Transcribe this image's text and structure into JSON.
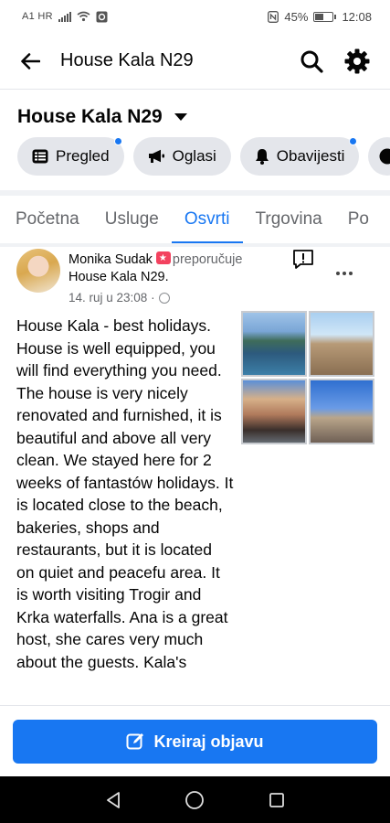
{
  "status_bar": {
    "carrier": "A1 HR",
    "battery": "45%",
    "time": "12:08"
  },
  "app_bar": {
    "title": "House Kala N29"
  },
  "page_header": {
    "name": "House Kala N29",
    "chips": [
      {
        "label": "Pregled",
        "icon": "dashboard-icon",
        "badge": true
      },
      {
        "label": "Oglasi",
        "icon": "megaphone-icon",
        "badge": false
      },
      {
        "label": "Obavijesti",
        "icon": "bell-icon",
        "badge": true
      }
    ]
  },
  "tabs": [
    {
      "label": "Početna",
      "active": false
    },
    {
      "label": "Usluge",
      "active": false
    },
    {
      "label": "Osvrti",
      "active": true
    },
    {
      "label": "Trgovina",
      "active": false
    },
    {
      "label": "Po",
      "active": false
    }
  ],
  "post": {
    "author": "Monika Sudak",
    "verb": "preporučuje",
    "page": "House Kala N29.",
    "timestamp": "14. ruj u 23:08 ·",
    "text": "House Kala - best holidays. House is well equipped, you will find everything you need. The house is very nicely renovated and furnished, it is beautiful and above all very clean. We stayed here for 2 weeks of fantastów holidays. It is located close to the beach, bakeries, shops and restaurants, but it is located on quiet and peacefu area. It is worth visiting Trogir and Krka waterfalls. Ana is a great host, she cares very much about the guests. Kala's"
  },
  "create_post": {
    "label": "Kreiraj objavu"
  },
  "colors": {
    "accent": "#1877f2",
    "chip_bg": "#e4e6eb",
    "recommend": "#f3425f"
  }
}
